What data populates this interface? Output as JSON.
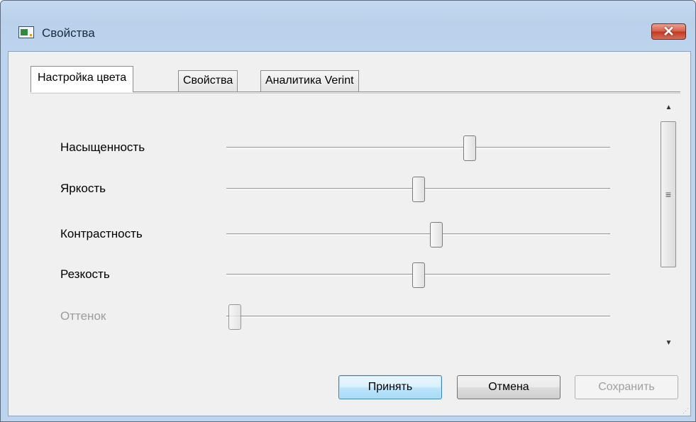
{
  "window": {
    "title": "Свойства",
    "close_glyph": "✕",
    "icon": "app-window-icon"
  },
  "tabs": [
    {
      "label": "Настройка цвета",
      "active": true
    },
    {
      "label": "Свойства",
      "active": false
    },
    {
      "label": "Аналитика Verint",
      "active": false
    }
  ],
  "sliders": [
    {
      "label": "Насыщенность",
      "value_fraction": 0.64,
      "enabled": true
    },
    {
      "label": "Яркость",
      "value_fraction": 0.5,
      "enabled": true
    },
    {
      "label": "Контрастность",
      "value_fraction": 0.55,
      "enabled": true
    },
    {
      "label": "Резкость",
      "value_fraction": 0.5,
      "enabled": true
    },
    {
      "label": "Оттенок",
      "value_fraction": 0.0,
      "enabled": false
    }
  ],
  "scrollbar": {
    "up_glyph": "▲",
    "down_glyph": "▼",
    "grip_glyph": "≡"
  },
  "buttons": {
    "accept": "Принять",
    "cancel": "Отмена",
    "save": "Сохранить"
  },
  "colors": {
    "title_bar": "#bcd4ee",
    "close_button": "#c0391f",
    "default_button": "#a7d9f5"
  }
}
